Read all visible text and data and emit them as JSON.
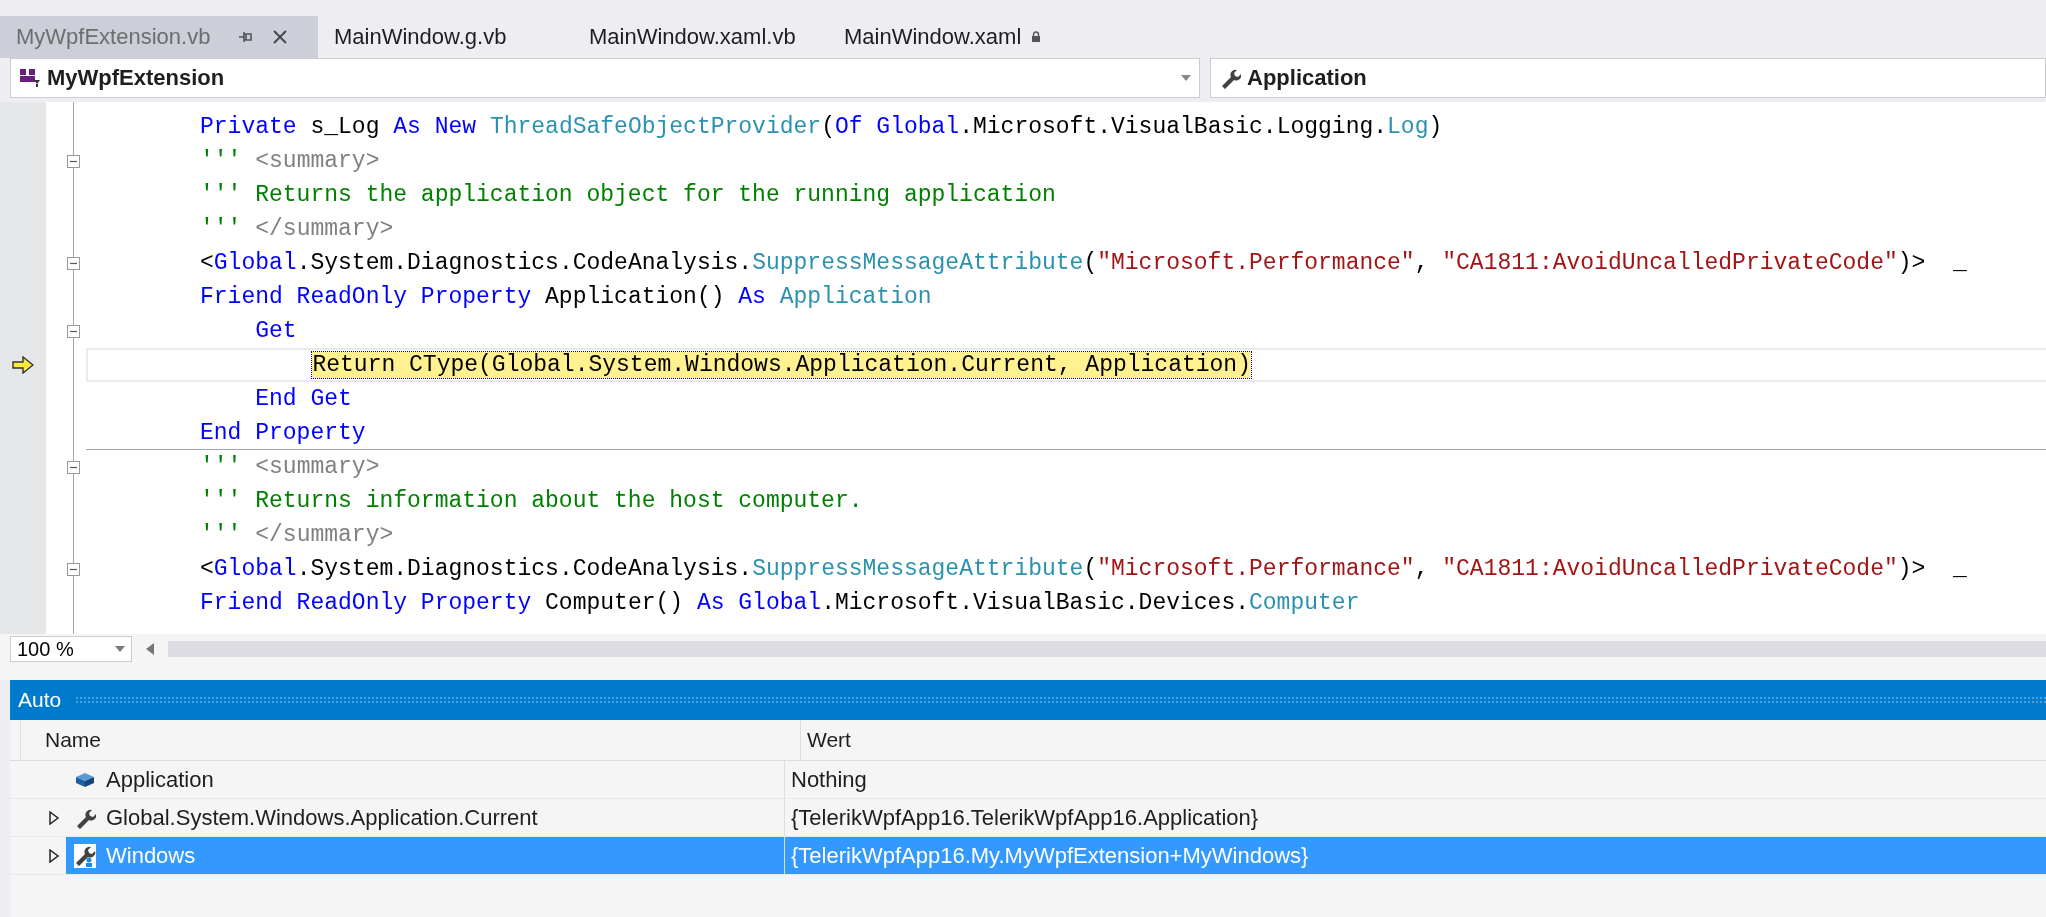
{
  "tabs": [
    {
      "label": "MyWpfExtension.vb",
      "selected": true,
      "locked": false
    },
    {
      "label": "MainWindow.g.vb",
      "selected": false,
      "locked": false
    },
    {
      "label": "MainWindow.xaml.vb",
      "selected": false,
      "locked": false
    },
    {
      "label": "MainWindow.xaml",
      "selected": false,
      "locked": true
    }
  ],
  "nav_bar": {
    "type_dropdown": "MyWpfExtension",
    "member_dropdown": "Application"
  },
  "code_lines": [
    {
      "fold": false,
      "current": false,
      "separator_after": false,
      "tokens": [
        {
          "kind": "keyword",
          "text": "Private"
        },
        {
          "kind": "plain",
          "text": " s_Log "
        },
        {
          "kind": "keyword",
          "text": "As New "
        },
        {
          "kind": "type",
          "text": "ThreadSafeObjectProvider"
        },
        {
          "kind": "plain",
          "text": "("
        },
        {
          "kind": "keyword",
          "text": "Of Global"
        },
        {
          "kind": "plain",
          "text": ".Microsoft.VisualBasic.Logging."
        },
        {
          "kind": "type",
          "text": "Log"
        },
        {
          "kind": "plain",
          "text": ")"
        }
      ]
    },
    {
      "fold": true,
      "current": false,
      "separator_after": false,
      "tokens": [
        {
          "kind": "comment",
          "text": "''' "
        },
        {
          "kind": "doc",
          "text": "<summary>"
        }
      ]
    },
    {
      "fold": false,
      "current": false,
      "separator_after": false,
      "tokens": [
        {
          "kind": "comment",
          "text": "''' Returns the application object for the running application"
        }
      ]
    },
    {
      "fold": false,
      "current": false,
      "separator_after": false,
      "tokens": [
        {
          "kind": "comment",
          "text": "''' "
        },
        {
          "kind": "doc",
          "text": "</summary>"
        }
      ]
    },
    {
      "fold": true,
      "current": false,
      "separator_after": false,
      "tokens": [
        {
          "kind": "plain",
          "text": "<"
        },
        {
          "kind": "keyword",
          "text": "Global"
        },
        {
          "kind": "plain",
          "text": ".System.Diagnostics.CodeAnalysis."
        },
        {
          "kind": "type",
          "text": "SuppressMessageAttribute"
        },
        {
          "kind": "plain",
          "text": "("
        },
        {
          "kind": "string",
          "text": "\"Microsoft.Performance\""
        },
        {
          "kind": "plain",
          "text": ", "
        },
        {
          "kind": "string",
          "text": "\"CA1811:AvoidUncalledPrivateCode\""
        },
        {
          "kind": "plain",
          "text": ")>  _"
        }
      ]
    },
    {
      "fold": false,
      "current": false,
      "separator_after": false,
      "tokens": [
        {
          "kind": "keyword",
          "text": "Friend ReadOnly Property"
        },
        {
          "kind": "plain",
          "text": " Application() "
        },
        {
          "kind": "keyword",
          "text": "As "
        },
        {
          "kind": "type",
          "text": "Application"
        }
      ]
    },
    {
      "fold": true,
      "current": false,
      "separator_after": false,
      "tokens": [
        {
          "kind": "keyword",
          "text": "    Get"
        }
      ]
    },
    {
      "fold": false,
      "current": true,
      "separator_after": false,
      "tokens": [
        {
          "kind": "plain",
          "text": "        Return CType(Global.System.Windows.Application.Current, Application)"
        }
      ]
    },
    {
      "fold": false,
      "current": false,
      "separator_after": false,
      "tokens": [
        {
          "kind": "keyword",
          "text": "    End Get"
        }
      ]
    },
    {
      "fold": false,
      "current": false,
      "separator_after": true,
      "tokens": [
        {
          "kind": "keyword",
          "text": "End Property"
        }
      ]
    },
    {
      "fold": true,
      "current": false,
      "separator_after": false,
      "tokens": [
        {
          "kind": "comment",
          "text": "''' "
        },
        {
          "kind": "doc",
          "text": "<summary>"
        }
      ]
    },
    {
      "fold": false,
      "current": false,
      "separator_after": false,
      "tokens": [
        {
          "kind": "comment",
          "text": "''' Returns information about the host computer."
        }
      ]
    },
    {
      "fold": false,
      "current": false,
      "separator_after": false,
      "tokens": [
        {
          "kind": "comment",
          "text": "''' "
        },
        {
          "kind": "doc",
          "text": "</summary>"
        }
      ]
    },
    {
      "fold": true,
      "current": false,
      "separator_after": false,
      "tokens": [
        {
          "kind": "plain",
          "text": "<"
        },
        {
          "kind": "keyword",
          "text": "Global"
        },
        {
          "kind": "plain",
          "text": ".System.Diagnostics.CodeAnalysis."
        },
        {
          "kind": "type",
          "text": "SuppressMessageAttribute"
        },
        {
          "kind": "plain",
          "text": "("
        },
        {
          "kind": "string",
          "text": "\"Microsoft.Performance\""
        },
        {
          "kind": "plain",
          "text": ", "
        },
        {
          "kind": "string",
          "text": "\"CA1811:AvoidUncalledPrivateCode\""
        },
        {
          "kind": "plain",
          "text": ")>  _"
        }
      ]
    },
    {
      "fold": false,
      "current": false,
      "separator_after": false,
      "tokens": [
        {
          "kind": "keyword",
          "text": "Friend ReadOnly Property"
        },
        {
          "kind": "plain",
          "text": " Computer() "
        },
        {
          "kind": "keyword",
          "text": "As Global"
        },
        {
          "kind": "plain",
          "text": ".Microsoft.VisualBasic.Devices."
        },
        {
          "kind": "type",
          "text": "Computer"
        }
      ]
    }
  ],
  "zoom": "100 %",
  "auto_panel": {
    "title": "Auto",
    "columns": [
      "Name",
      "Wert"
    ],
    "rows": [
      {
        "kind": "field",
        "name": "Application",
        "value": "Nothing",
        "expandable": false,
        "selected": false
      },
      {
        "kind": "property",
        "name": "Global.System.Windows.Application.Current",
        "value": "{TelerikWpfApp16.TelerikWpfApp16.Application}",
        "expandable": true,
        "selected": false
      },
      {
        "kind": "member",
        "name": "Windows",
        "value": "{TelerikWpfApp16.My.MyWpfExtension+MyWindows}",
        "expandable": true,
        "selected": true
      }
    ]
  }
}
